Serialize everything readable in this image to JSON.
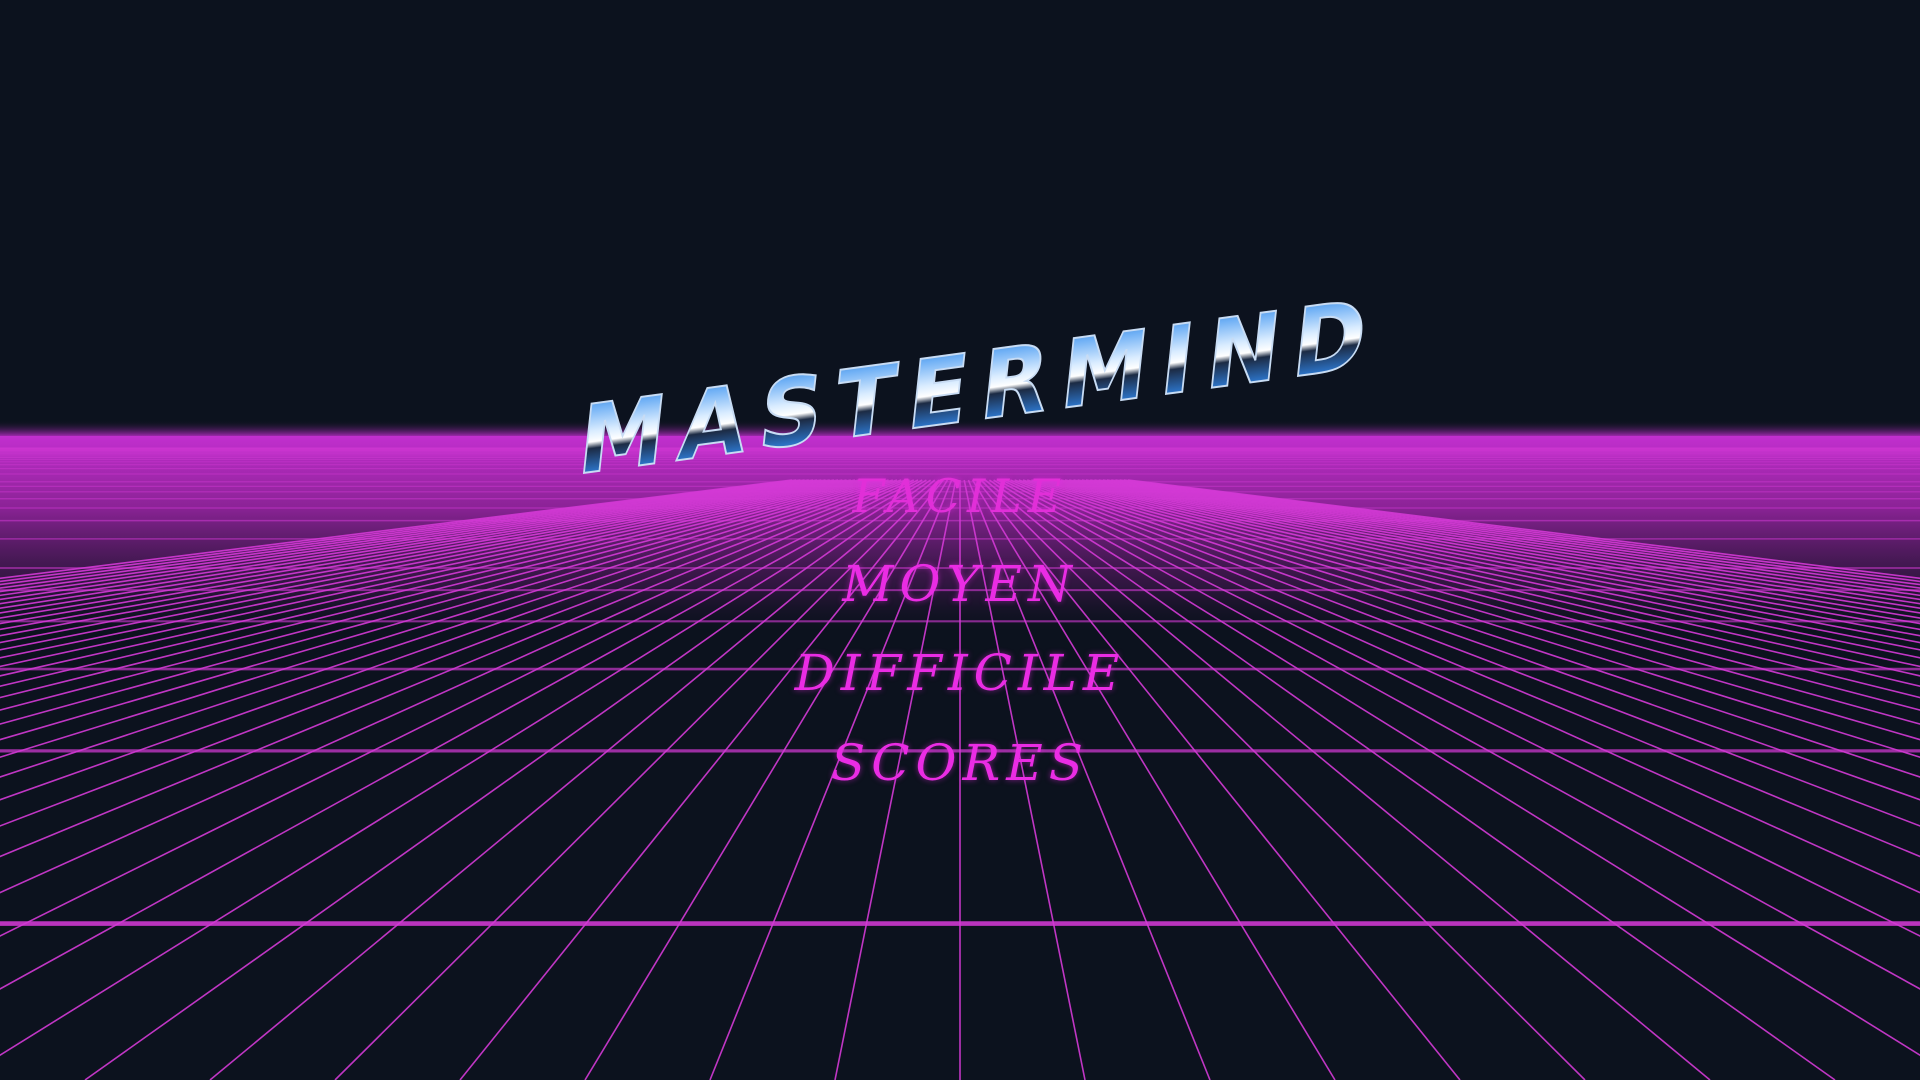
{
  "game": {
    "title": "MASTERMIND"
  },
  "menu": {
    "items": [
      {
        "id": "facile",
        "label": "FACILE"
      },
      {
        "id": "moyen",
        "label": "MOYEN"
      },
      {
        "id": "difficile",
        "label": "DIFFICILE"
      },
      {
        "id": "scores",
        "label": "SCORES"
      }
    ]
  },
  "colors": {
    "background": "#0c121e",
    "grid": "#d43ad6",
    "horizon_glow": "#c22fcf",
    "menu_text": "#ea2ce4",
    "title_chrome_top": "#9ecbff",
    "title_chrome_mid": "#ffffff",
    "title_chrome_bottom": "#1f5fae"
  }
}
